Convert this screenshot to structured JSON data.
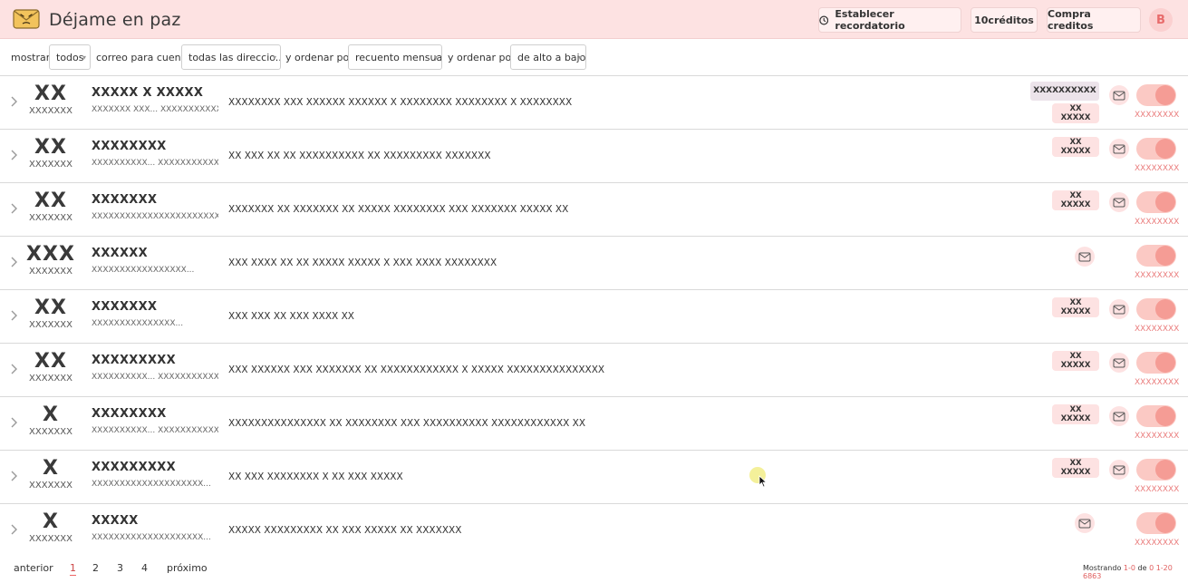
{
  "app": {
    "title": "Déjame en paz"
  },
  "header": {
    "reminder_label": "Establecer recordatorio",
    "credits_label": "10créditos",
    "buy_label": "Compra creditos",
    "avatar_initial": "B"
  },
  "filters": {
    "show_label": "mostrar",
    "show_value": "todos",
    "account_label": "correo para cuenta",
    "account_value": "todas las direccio...",
    "order_label": "y ordenar por",
    "order_value": "recuento mensual",
    "order2_label": "y ordenar por",
    "order2_value": "de alto a bajo"
  },
  "rows": [
    {
      "code": "XX",
      "code_sub": "XXXXXXX",
      "subject": "XXXXX X XXXXX",
      "sender": "XXXXXXX XXX... XXXXXXXXXXX...",
      "snippet": "XXXXXXXX XXX XXXXXX XXXXXX X XXXXXXXX XXXXXXXX X XXXXXXXX",
      "extra_tag": "XXXXXXXXXX",
      "badge_top": "XX",
      "badge_bottom": "XXXXX",
      "toggle_label": "XXXXXXXX"
    },
    {
      "code": "XX",
      "code_sub": "XXXXXXX",
      "subject": "XXXXXXXX",
      "sender": "XXXXXXXXXX... XXXXXXXXXXX...",
      "snippet": "XX XXX XX XX XXXXXXXXXX XX XXXXXXXXX XXXXXXX",
      "extra_tag": "",
      "badge_top": "XX",
      "badge_bottom": "XXXXX",
      "toggle_label": "XXXXXXXX"
    },
    {
      "code": "XX",
      "code_sub": "XXXXXXX",
      "subject": "XXXXXXX",
      "sender": "XXXXXXXXXXXXXXXXXXXXXXX",
      "snippet": "XXXXXXX XX XXXXXXX XX XXXXX XXXXXXXX XXX XXXXXXX XXXXX XX",
      "extra_tag": "",
      "badge_top": "XX",
      "badge_bottom": "XXXXX",
      "toggle_label": "XXXXXXXX"
    },
    {
      "code": "XXX",
      "code_sub": "XXXXXXX",
      "subject": "XXXXXX",
      "sender": "XXXXXXXXXXXXXXXXX...",
      "snippet": "XXX XXXX XX XX XXXXX XXXXX X XXX XXXX XXXXXXXX",
      "extra_tag": "",
      "badge_top": "",
      "badge_bottom": "",
      "toggle_label": "XXXXXXXX"
    },
    {
      "code": "XX",
      "code_sub": "XXXXXXX",
      "subject": "XXXXXXX",
      "sender": "XXXXXXXXXXXXXXX...",
      "snippet": "XXX XXX XX XXX XXXX XX",
      "extra_tag": "",
      "badge_top": "XX",
      "badge_bottom": "XXXXX",
      "toggle_label": "XXXXXXXX"
    },
    {
      "code": "XX",
      "code_sub": "XXXXXXX",
      "subject": "XXXXXXXXX",
      "sender": "XXXXXXXXXX... XXXXXXXXXXX...",
      "snippet": "XXX XXXXXX XXX XXXXXXX XX XXXXXXXXXXXX X XXXXX XXXXXXXXXXXXXXX",
      "extra_tag": "",
      "badge_top": "XX",
      "badge_bottom": "XXXXX",
      "toggle_label": "XXXXXXXX"
    },
    {
      "code": "X",
      "code_sub": "XXXXXXX",
      "subject": "XXXXXXXX",
      "sender": "XXXXXXXXXX... XXXXXXXXXXX...",
      "snippet": "XXXXXXXXXXXXXXX XX XXXXXXXX XXX XXXXXXXXXX XXXXXXXXXXXX XX",
      "extra_tag": "",
      "badge_top": "XX",
      "badge_bottom": "XXXXX",
      "toggle_label": "XXXXXXXX"
    },
    {
      "code": "X",
      "code_sub": "XXXXXXX",
      "subject": "XXXXXXXXX",
      "sender": "XXXXXXXXXXXXXXXXXXXX...",
      "snippet": "XX XXX XXXXXXXX X XX XXX XXXXX",
      "extra_tag": "",
      "badge_top": "XX",
      "badge_bottom": "XXXXX",
      "toggle_label": "XXXXXXXX"
    },
    {
      "code": "X",
      "code_sub": "XXXXXXX",
      "subject": "XXXXX",
      "sender": "XXXXXXXXXXXXXXXXXXXX...",
      "snippet": "XXXXX XXXXXXXXX XX XXX XXXXX XX XXXXXXX",
      "extra_tag": "",
      "badge_top": "",
      "badge_bottom": "",
      "toggle_label": "XXXXXXXX"
    }
  ],
  "pagination": {
    "prev_label": "anterior",
    "pages": [
      "1",
      "2",
      "3",
      "4"
    ],
    "current_page": "1",
    "next_label": "próximo",
    "showing_prefix": "Mostrando",
    "showing_range": "1-0",
    "showing_of": "de",
    "showing_total": "0 1-20 6863"
  },
  "colors": {
    "header_bg": "#fde2e2",
    "accent": "#f59c95",
    "accent_text": "#ea7d7d"
  },
  "icons": {
    "logo": "envelope-face-icon",
    "reminder": "clock-icon",
    "row_expand": "chevron-right-icon",
    "row_mail": "open-envelope-icon"
  }
}
